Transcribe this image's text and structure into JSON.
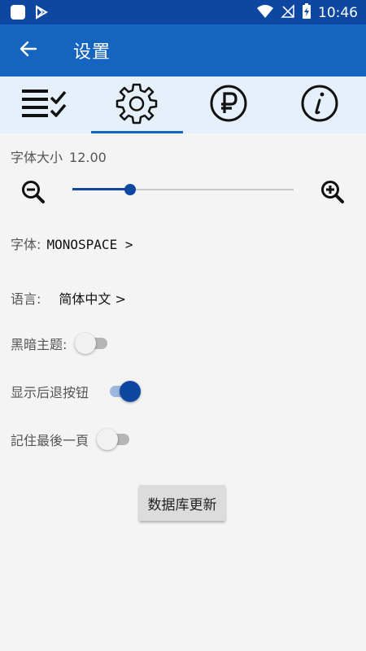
{
  "status_bar": {
    "time": "10:46",
    "icons": [
      "app-square-icon",
      "play-store-icon",
      "wifi-icon",
      "no-signal-icon",
      "battery-charging-icon"
    ]
  },
  "app_bar": {
    "title": "设置",
    "back_icon": "arrow-left-icon"
  },
  "tabs": [
    {
      "icon": "checklist-icon",
      "selected": false
    },
    {
      "icon": "gear-icon",
      "selected": true
    },
    {
      "icon": "ruble-icon",
      "selected": false
    },
    {
      "icon": "info-icon",
      "selected": false
    }
  ],
  "settings": {
    "font_size_label": "字体大小",
    "font_size_value": "12.00",
    "font_size_slider_fraction": 0.26,
    "font_label": "字体:",
    "font_value": "MONOSPACE >",
    "language_label": "语言:",
    "language_value": "简体中文 >",
    "toggles": [
      {
        "label": "黑暗主题:",
        "on": false
      },
      {
        "label": "显示后退按钮",
        "on": true
      },
      {
        "label": "記住最後一頁",
        "on": false
      }
    ],
    "update_db_button": "数据库更新"
  },
  "colors": {
    "status_bar": "#0d47a1",
    "app_bar": "#1565c0",
    "tab_bar": "#e6f0fb",
    "accent": "#0d47a1"
  }
}
